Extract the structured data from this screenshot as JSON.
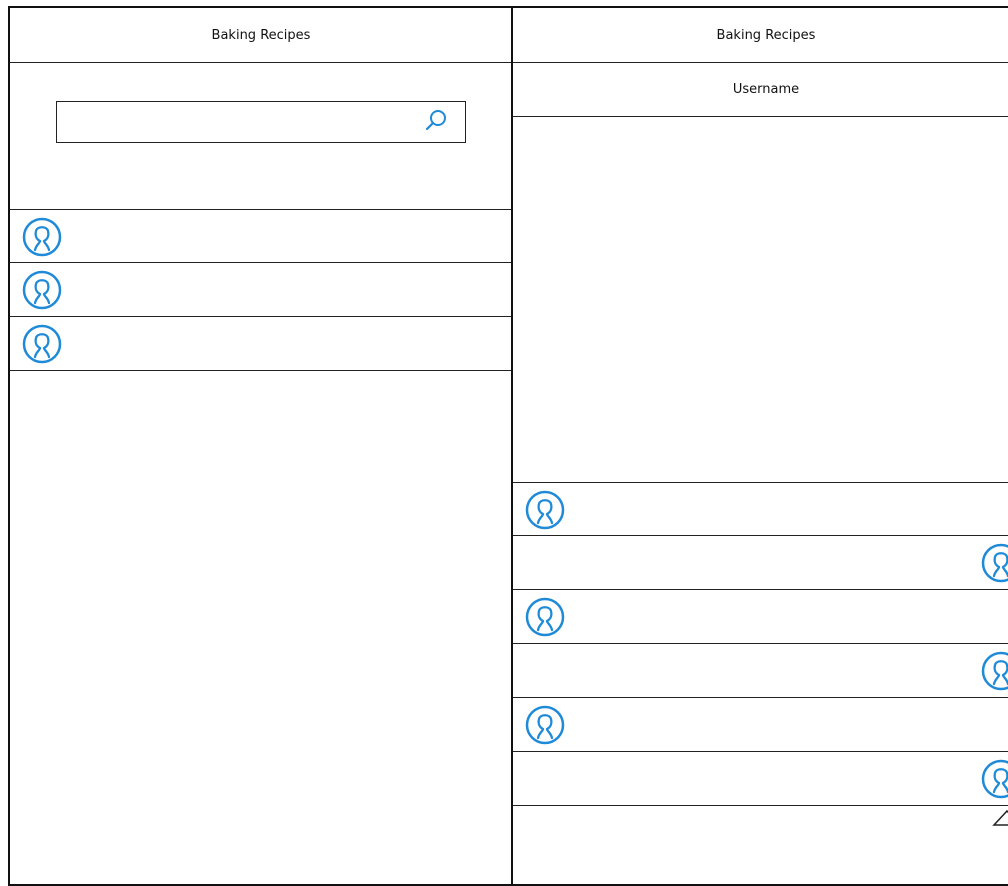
{
  "left_screen": {
    "title": "Baking Recipes",
    "search": {
      "value": "",
      "placeholder": ""
    },
    "user_rows": [
      {
        "icon": "user-avatar-icon"
      },
      {
        "icon": "user-avatar-icon"
      },
      {
        "icon": "user-avatar-icon"
      }
    ]
  },
  "right_screen": {
    "title": "Baking Recipes",
    "subtitle": "Username",
    "message_rows": [
      {
        "side": "left",
        "icon": "user-avatar-icon"
      },
      {
        "side": "right",
        "icon": "user-avatar-icon"
      },
      {
        "side": "left",
        "icon": "user-avatar-icon"
      },
      {
        "side": "right",
        "icon": "user-avatar-icon"
      },
      {
        "side": "left",
        "icon": "user-avatar-icon"
      },
      {
        "side": "right",
        "icon": "user-avatar-icon"
      }
    ],
    "bottom_control_icon": "triangle-up-icon"
  },
  "colors": {
    "border": "#222222",
    "accent": "#1f8ad7"
  }
}
